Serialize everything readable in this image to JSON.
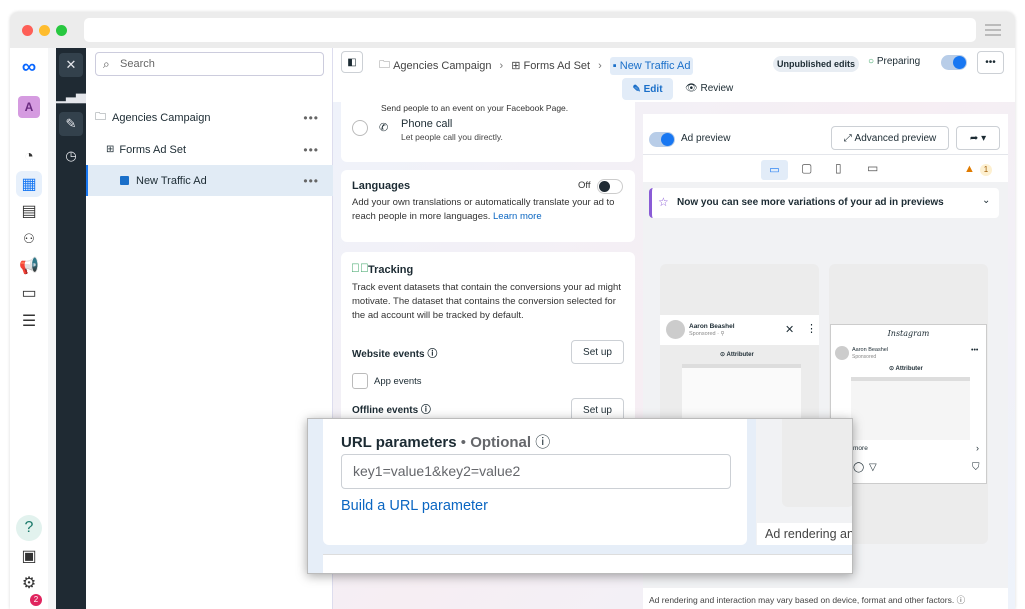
{
  "sidebar": {
    "account_initial": "A",
    "icons": [
      "meta-logo",
      "dashboard-icon",
      "campaigns-icon",
      "pages-icon",
      "audiences-icon",
      "ads-icon",
      "billing-icon",
      "menu-icon",
      "help-icon",
      "news-icon",
      "settings-icon"
    ],
    "notification_count": "2"
  },
  "tool_strip": {
    "icons": [
      "close-icon",
      "chart-icon",
      "edit-icon",
      "history-icon"
    ]
  },
  "tree": {
    "search_placeholder": "Search",
    "items": [
      {
        "label": "Agencies Campaign",
        "icon": "folder-icon"
      },
      {
        "label": "Forms Ad Set",
        "icon": "adset-icon"
      },
      {
        "label": "New Traffic Ad",
        "icon": "ad-icon",
        "selected": true
      }
    ]
  },
  "header": {
    "breadcrumb": [
      "Agencies Campaign",
      "Forms Ad Set",
      "New Traffic Ad"
    ],
    "status_badge": "Unpublished edits",
    "status": "Preparing",
    "tabs": [
      "Edit",
      "Review"
    ]
  },
  "form": {
    "event_option_desc": "Send people to an event on your Facebook Page.",
    "phone_call": {
      "title": "Phone call",
      "desc": "Let people call you directly."
    },
    "languages": {
      "title": "Languages",
      "toggle_label": "Off",
      "desc": "Add your own translations or automatically translate your ad to reach people in more languages.",
      "link": "Learn more"
    },
    "tracking": {
      "title": "Tracking",
      "desc": "Track event datasets that contain the conversions your ad might motivate. The dataset that contains the conversion selected for the ad account will be tracked by default.",
      "website_events": "Website events",
      "app_events": "App events",
      "offline_events": "Offline events",
      "setup_label": "Set up"
    }
  },
  "preview": {
    "toggle_label": "Ad preview",
    "advanced_label": "Advanced preview",
    "warning_count": "1",
    "banner": "Now you can see more variations of your ad in previews",
    "fb_card": {
      "name": "Aaron Beashel",
      "sub": "Sponsored · ⚲",
      "brand": "Attributer"
    },
    "ig_card": {
      "logo": "Instagram",
      "name": "Aaron Beashel",
      "sub": "Sponsored",
      "brand": "Attributer",
      "more": "more"
    },
    "footer": "Ad rendering and interaction may vary based on device, format and other factors."
  },
  "overlay": {
    "title": "URL parameters",
    "optional": "Optional",
    "input_value": "key1=value1&key2=value2",
    "link": "Build a URL parameter",
    "right_text": "Ad rendering an"
  },
  "colors": {
    "accent": "#1877f2",
    "link": "#0a66c2",
    "dark_strip": "#1f2a33",
    "success": "#2e9e5b",
    "warning": "#e07b00"
  }
}
